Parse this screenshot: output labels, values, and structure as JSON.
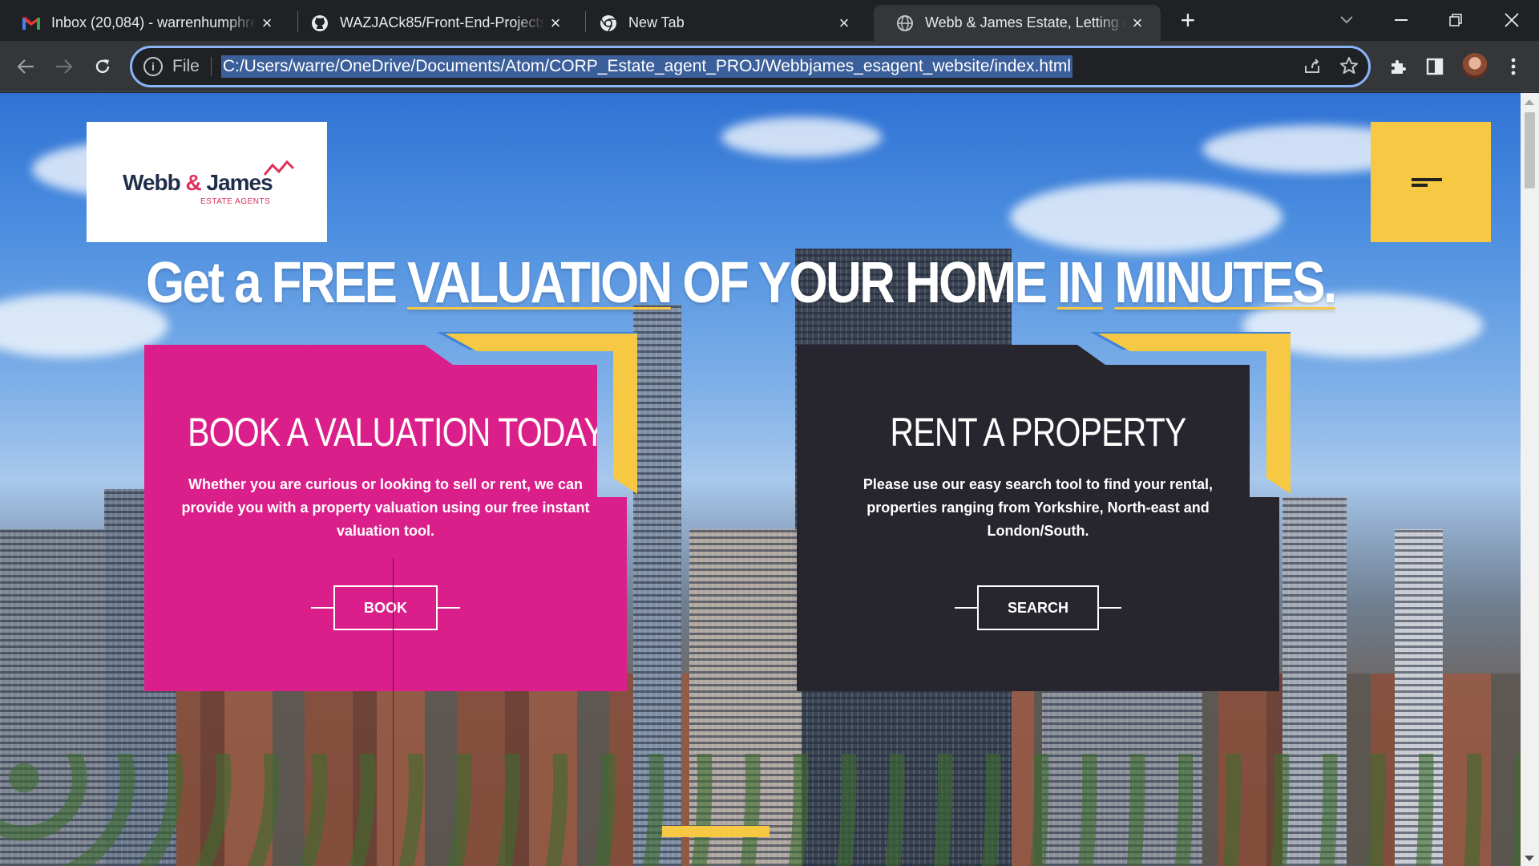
{
  "browser": {
    "tabs": [
      {
        "title": "Inbox (20,084) - warrenhumphreys",
        "icon": "gmail-icon"
      },
      {
        "title": "WAZJACk85/Front-End-Projects: ",
        "icon": "github-icon"
      },
      {
        "title": "New Tab",
        "icon": "chrome-icon"
      },
      {
        "title": "Webb & James Estate, Letting & ",
        "icon": "globe-icon"
      }
    ],
    "omnibox": {
      "scheme_label": "File",
      "url": "C:/Users/warre/OneDrive/Documents/Atom/CORP_Estate_agent_PROJ/Webbjames_esagent_website/index.html"
    }
  },
  "site": {
    "logo": {
      "name_part1": "Webb ",
      "amp": "&",
      "name_part2": " James",
      "tagline": "ESTATE AGENTS"
    },
    "headline": {
      "w1": "Get a ",
      "w2": "FREE ",
      "w3": "VALUATION",
      "w4": " OF YOUR HOME ",
      "w5": "IN",
      "w6": " ",
      "w7": "MINUTES."
    },
    "cards": {
      "valuation": {
        "title": "BOOK A VALUATION TODAY",
        "description": "Whether you are curious or looking to sell or rent, we can provide you with a property valuation using our free instant valuation tool.",
        "button": "BOOK"
      },
      "rent": {
        "title": "RENT A PROPERTY",
        "description": "Please use our easy search tool to find your rental, properties ranging from Yorkshire, North-east and London/South.",
        "button": "SEARCH"
      }
    },
    "colors": {
      "pink": "#db1f8a",
      "dark": "#27262e",
      "yellow": "#f7c843",
      "blue": "#3f83d8"
    }
  }
}
